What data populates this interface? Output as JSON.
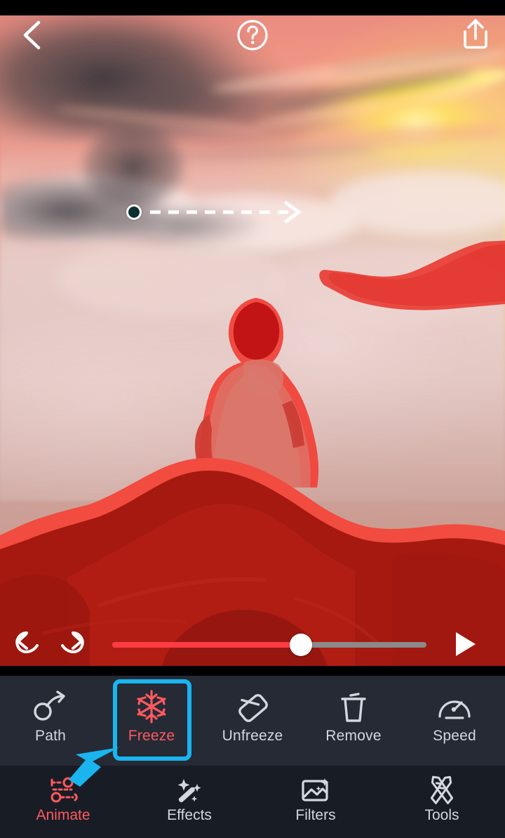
{
  "app": {
    "name": "video-editor",
    "accent_red": "#ff5a5f",
    "accent_blue": "#1ab4ef",
    "toolbar_bg": "#252a35",
    "navbar_bg": "#181c25"
  },
  "topbar": {
    "back_icon": "chevron-left-icon",
    "help_icon": "question-mark-circle-icon",
    "share_icon": "share-upload-icon"
  },
  "canvas": {
    "description": "Sunset photo of a person in a hoodie sitting on a rocky summit above a sea of clouds, with a red freeze-mask overlay painted on the rock, the person and a cloud at the right.",
    "mask_color": "#e8352e",
    "path": {
      "handle_icon": "path-start-dot",
      "arrow_icon": "arrow-right-icon",
      "dashed": true
    }
  },
  "player": {
    "undo_icon": "undo-arrow-icon",
    "redo_icon": "redo-arrow-icon",
    "play_icon": "play-triangle-icon",
    "progress_percent": 60,
    "fill_color": "#ff3b44",
    "track_color": "#8a8a8a"
  },
  "tools": {
    "items": [
      {
        "label": "Path",
        "icon": "path-node-arrow-icon",
        "active": false
      },
      {
        "label": "Freeze",
        "icon": "snowflake-icon",
        "active": true
      },
      {
        "label": "Unfreeze",
        "icon": "eraser-icon",
        "active": false
      },
      {
        "label": "Remove",
        "icon": "trash-can-icon",
        "active": false
      },
      {
        "label": "Speed",
        "icon": "speedometer-icon",
        "active": false
      }
    ],
    "highlighted": "Freeze"
  },
  "nav": {
    "items": [
      {
        "label": "Animate",
        "icon": "motion-path-nodes-icon",
        "active": true
      },
      {
        "label": "Effects",
        "icon": "magic-wand-icon",
        "active": false
      },
      {
        "label": "Filters",
        "icon": "photo-sparkle-icon",
        "active": false
      },
      {
        "label": "Tools",
        "icon": "pencil-ruler-icon",
        "active": false
      }
    ],
    "selected": "Animate"
  },
  "cursor": {
    "icon": "pointer-arrow-icon",
    "color": "#1ab4ef",
    "points_to": "Freeze"
  }
}
